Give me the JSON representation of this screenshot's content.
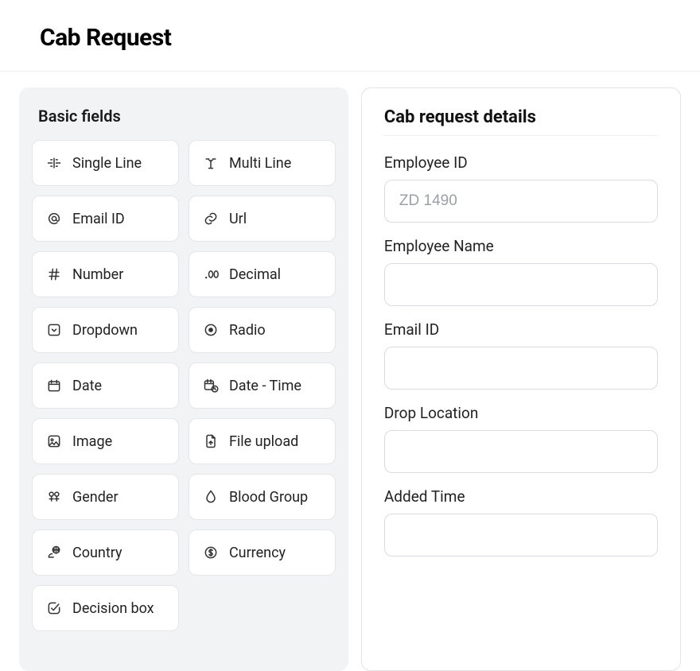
{
  "header": {
    "title": "Cab Request"
  },
  "palette": {
    "title": "Basic fields",
    "items": [
      {
        "icon": "single-line-icon",
        "label": "Single Line"
      },
      {
        "icon": "multi-line-icon",
        "label": "Multi Line"
      },
      {
        "icon": "email-icon",
        "label": "Email ID"
      },
      {
        "icon": "url-icon",
        "label": "Url"
      },
      {
        "icon": "number-icon",
        "label": "Number"
      },
      {
        "icon": "decimal-icon",
        "label": "Decimal"
      },
      {
        "icon": "dropdown-icon",
        "label": "Dropdown"
      },
      {
        "icon": "radio-icon",
        "label": "Radio"
      },
      {
        "icon": "date-icon",
        "label": "Date"
      },
      {
        "icon": "datetime-icon",
        "label": "Date - Time"
      },
      {
        "icon": "image-icon",
        "label": "Image"
      },
      {
        "icon": "file-upload-icon",
        "label": "File upload"
      },
      {
        "icon": "gender-icon",
        "label": "Gender"
      },
      {
        "icon": "blood-group-icon",
        "label": "Blood Group"
      },
      {
        "icon": "country-icon",
        "label": "Country"
      },
      {
        "icon": "currency-icon",
        "label": "Currency"
      },
      {
        "icon": "decision-box-icon",
        "label": "Decision box"
      }
    ]
  },
  "form": {
    "title": "Cab request details",
    "fields": [
      {
        "key": "employee_id",
        "label": "Employee ID",
        "placeholder": "ZD 1490",
        "value": ""
      },
      {
        "key": "employee_name",
        "label": "Employee Name",
        "placeholder": "",
        "value": ""
      },
      {
        "key": "email_id",
        "label": "Email ID",
        "placeholder": "",
        "value": ""
      },
      {
        "key": "drop_location",
        "label": "Drop Location",
        "placeholder": "",
        "value": ""
      },
      {
        "key": "added_time",
        "label": "Added Time",
        "placeholder": "",
        "value": ""
      }
    ]
  }
}
